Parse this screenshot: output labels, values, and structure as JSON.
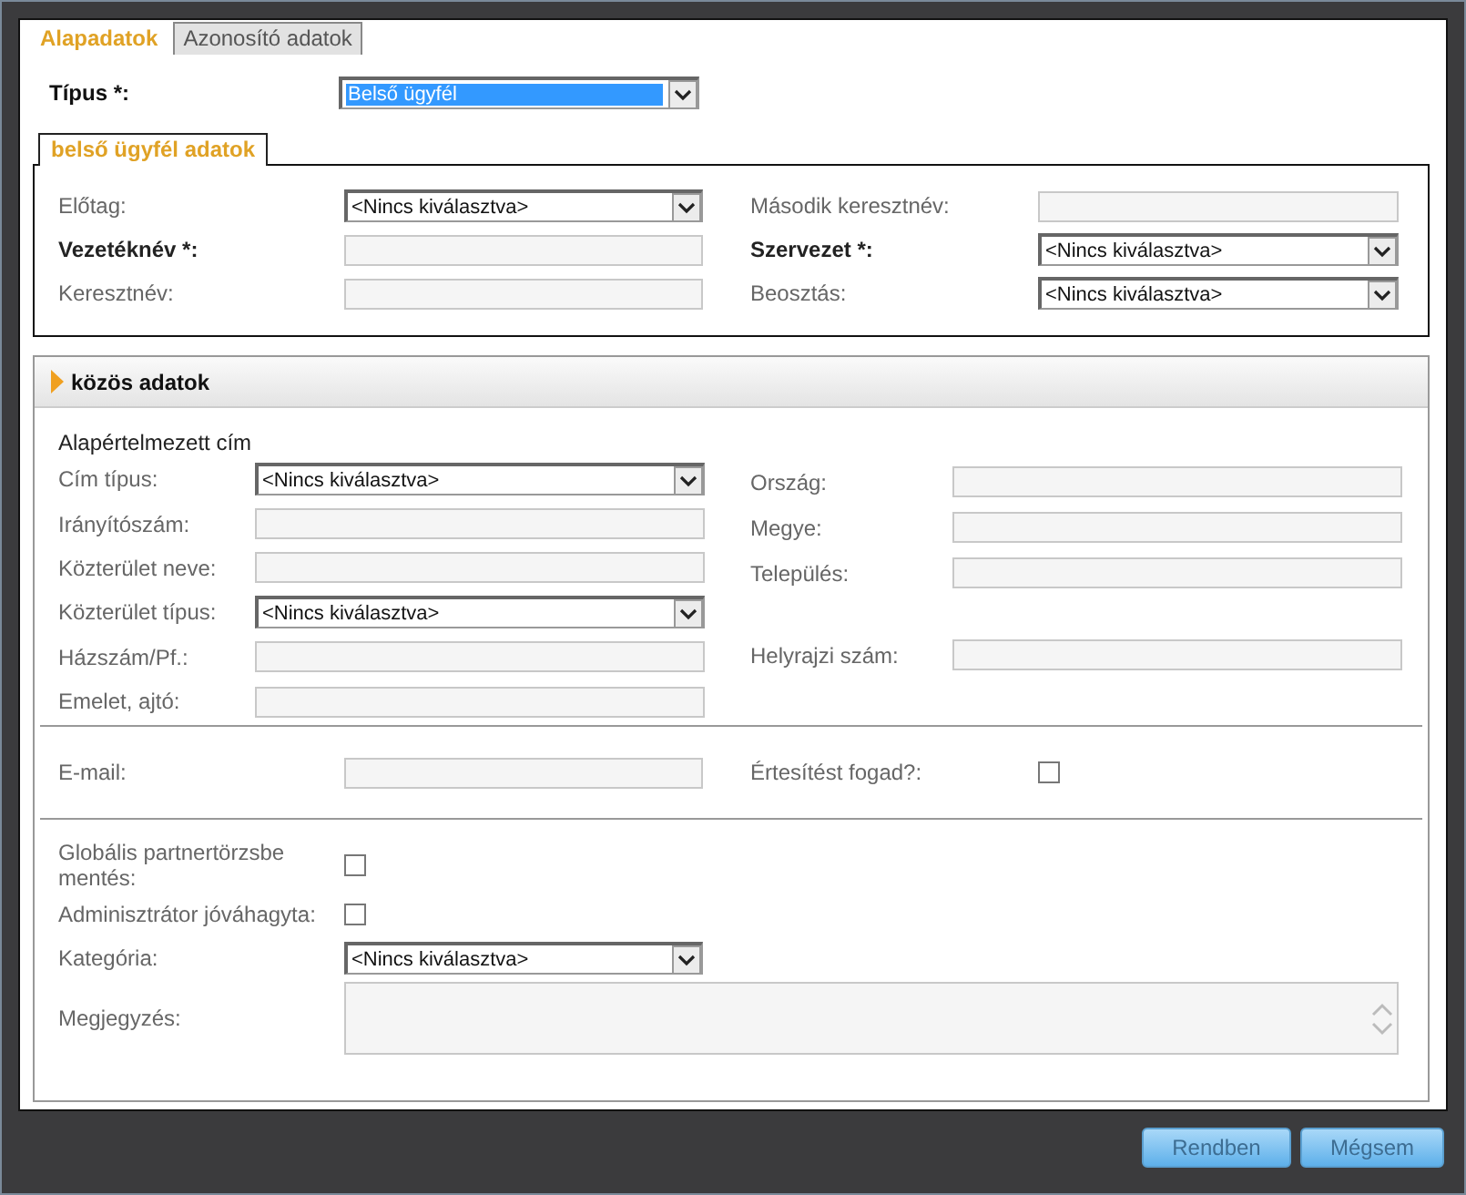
{
  "tabs": [
    {
      "label": "Alapadatok",
      "selected": true
    },
    {
      "label": "Azonosító adatok",
      "selected": false
    }
  ],
  "type_field": {
    "label": "Típus *:",
    "value": "Belső ügyfél",
    "highlighted": true
  },
  "internal": {
    "tab": "belső ügyfél adatok",
    "left": [
      {
        "label": "Előtag:",
        "kind": "select",
        "value": "<Nincs kiválasztva>",
        "required": false
      },
      {
        "label": "Vezetéknév *:",
        "kind": "text",
        "required": true
      },
      {
        "label": "Keresztnév:",
        "kind": "text",
        "required": false
      }
    ],
    "right": [
      {
        "label": "Második keresztnév:",
        "kind": "text",
        "required": false
      },
      {
        "label": "Szervezet *:",
        "kind": "select",
        "value": "<Nincs kiválasztva>",
        "required": true
      },
      {
        "label": "Beosztás:",
        "kind": "select",
        "value": "<Nincs kiválasztva>",
        "required": false
      }
    ]
  },
  "common": {
    "title": "közös adatok",
    "subtitle": "Alapértelmezett cím",
    "left": [
      {
        "label": "Cím típus:",
        "kind": "select",
        "value": "<Nincs kiválasztva>"
      },
      {
        "label": "Irányítószám:",
        "kind": "text"
      },
      {
        "label": "Közterület neve:",
        "kind": "text"
      },
      {
        "label": "Közterület típus:",
        "kind": "select",
        "value": "<Nincs kiválasztva>"
      },
      {
        "label": "Házszám/Pf.:",
        "kind": "text"
      },
      {
        "label": "Emelet, ajtó:",
        "kind": "text"
      }
    ],
    "right_groups": [
      [
        {
          "label": "Ország:",
          "kind": "text"
        },
        {
          "label": "Megye:",
          "kind": "text"
        },
        {
          "label": "Település:",
          "kind": "text"
        }
      ],
      [
        {
          "label": "Helyrajzi szám:",
          "kind": "text"
        }
      ]
    ],
    "email": {
      "label": "E-mail:",
      "kind": "text"
    },
    "notify": {
      "label": "Értesítést fogad?:",
      "kind": "checkbox",
      "checked": false
    },
    "bottom": [
      {
        "label": "Globális partnertörzsbe mentés:",
        "kind": "checkbox",
        "checked": false
      },
      {
        "label": "Adminisztrátor jóváhagyta:",
        "kind": "checkbox",
        "checked": false
      },
      {
        "label": "Kategória:",
        "kind": "select",
        "value": "<Nincs kiválasztva>"
      },
      {
        "label": "Megjegyzés:",
        "kind": "textarea"
      }
    ]
  },
  "buttons": [
    "Rendben",
    "Mégsem"
  ]
}
